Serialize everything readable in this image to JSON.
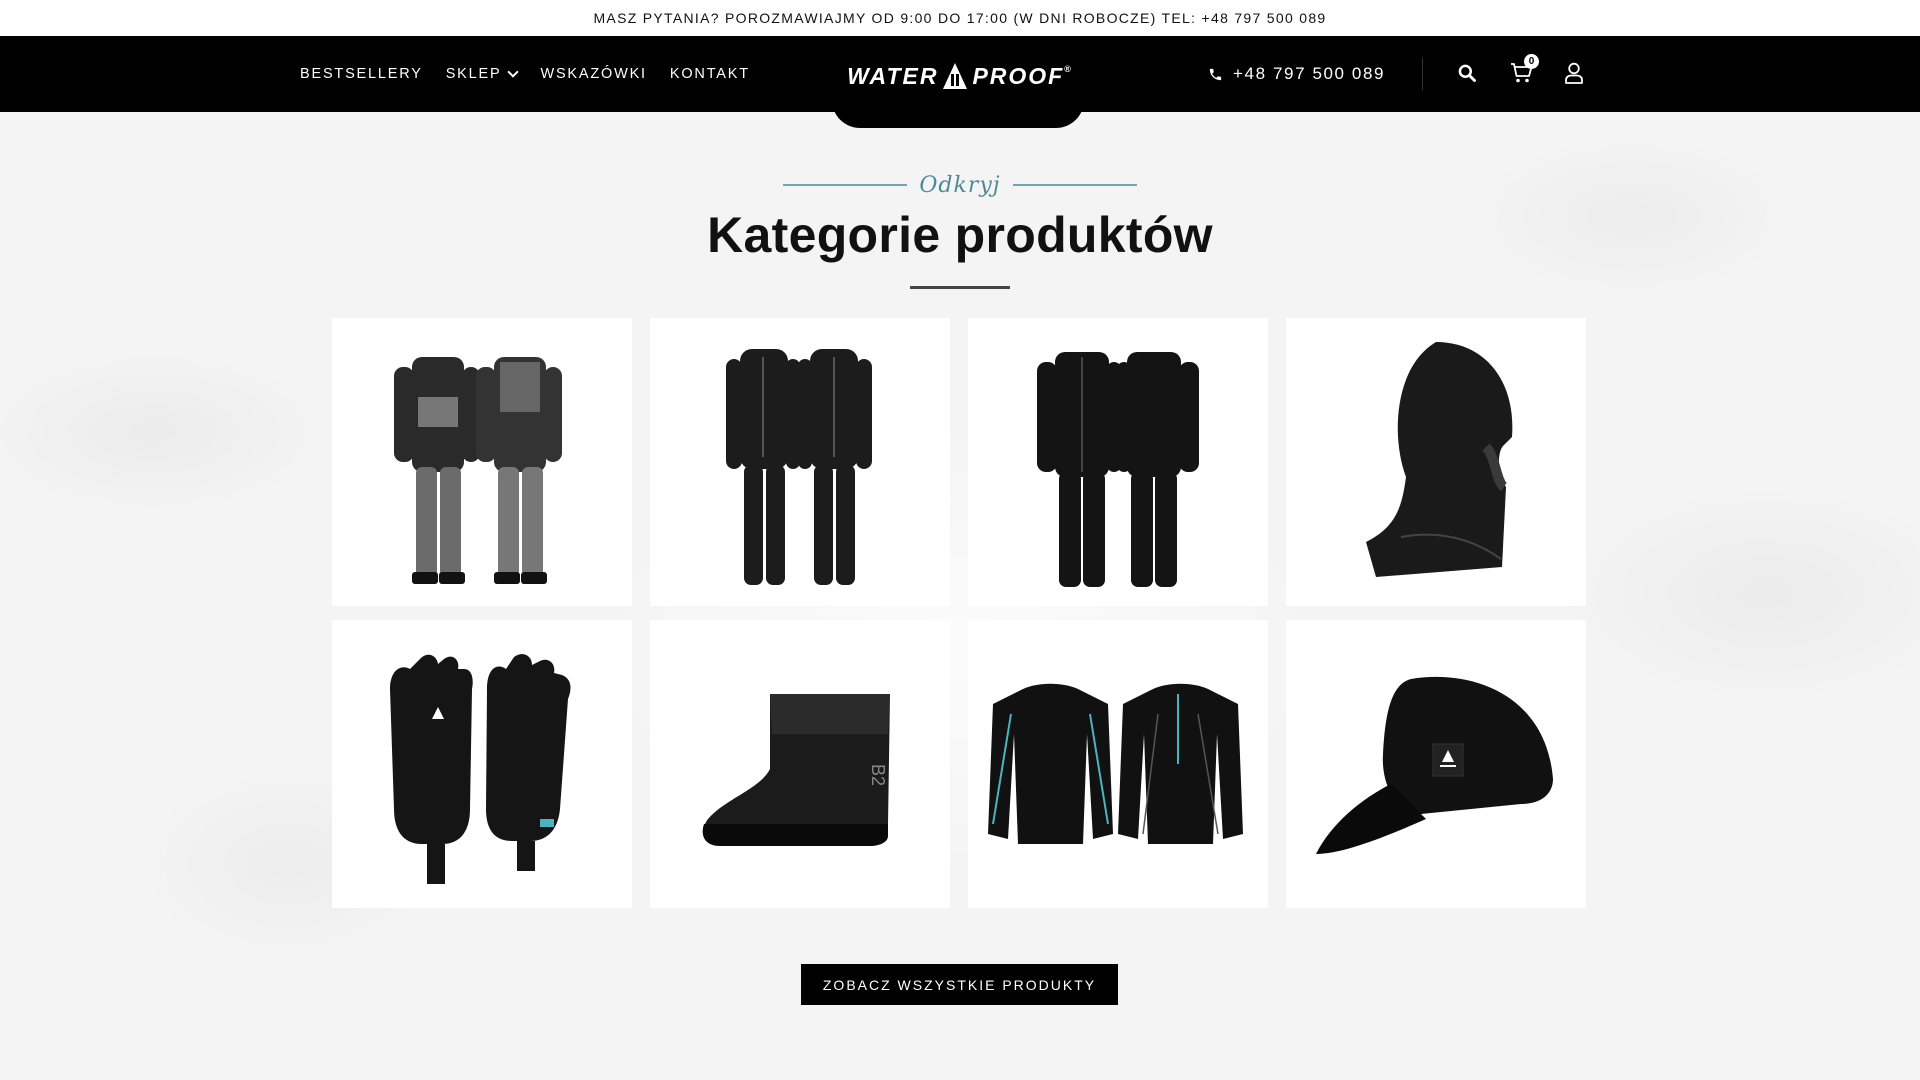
{
  "topbar": {
    "text": "MASZ PYTANIA? POROZMAWIAJMY OD 9:00 DO 17:00 (W DNI ROBOCZE) TEL: +48 797 500 089"
  },
  "header": {
    "nav": [
      {
        "label": "BESTSELLERY"
      },
      {
        "label": "SKLEP",
        "has_dropdown": true
      },
      {
        "label": "WSKAZÓWKI"
      },
      {
        "label": "KONTAKT"
      }
    ],
    "logo": {
      "left": "WATER",
      "right": "PROOF",
      "mark": "®"
    },
    "phone": "+48 797 500 089",
    "cart_count": "0",
    "icons": [
      "phone-icon",
      "search-icon",
      "cart-icon",
      "user-icon"
    ]
  },
  "section": {
    "eyebrow": "Odkryj",
    "title": "Kategorie produktów"
  },
  "products": [
    {
      "name": "drysuit-icon"
    },
    {
      "name": "wetsuit-icon"
    },
    {
      "name": "undersuit-icon"
    },
    {
      "name": "hood-icon"
    },
    {
      "name": "gloves-icon"
    },
    {
      "name": "boot-icon"
    },
    {
      "name": "rashguard-icon"
    },
    {
      "name": "cap-icon"
    }
  ],
  "cta": {
    "label": "ZOBACZ WSZYSTKIE PRODUKTY"
  },
  "colors": {
    "header_bg": "#000000",
    "accent": "#4d8a98",
    "page_bg": "#f4f4f4"
  }
}
